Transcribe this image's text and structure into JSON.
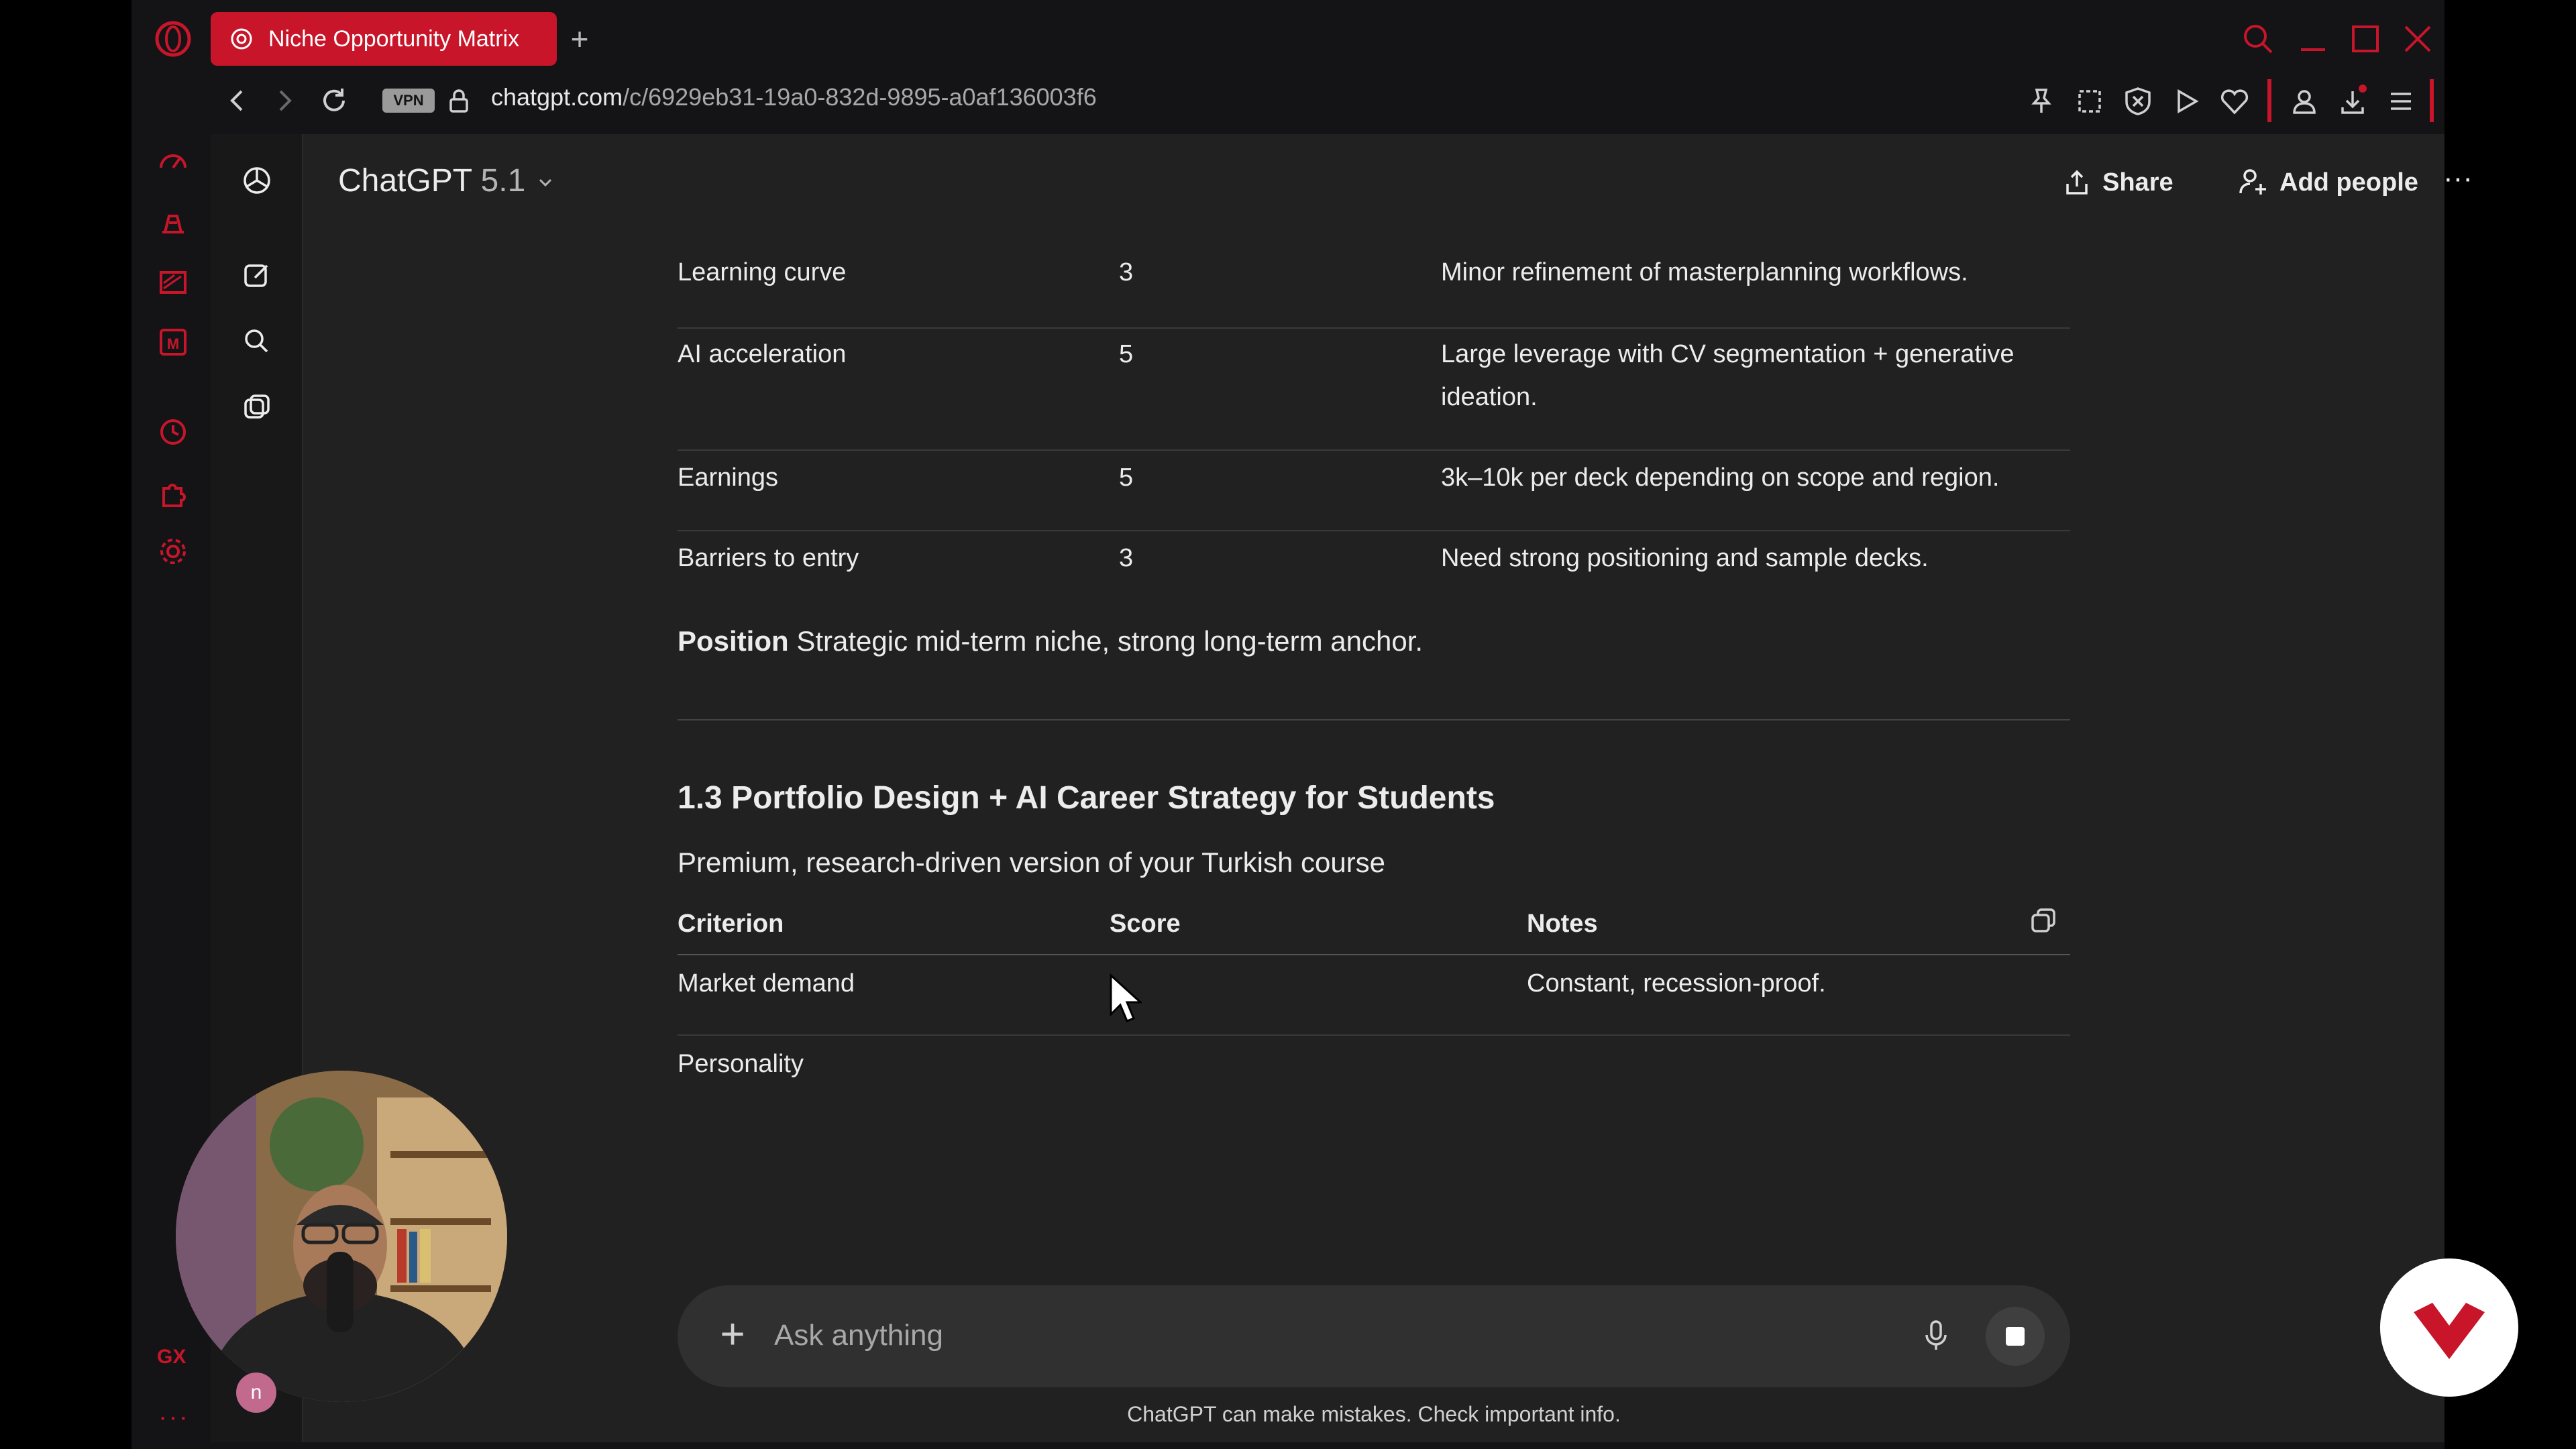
{
  "browser": {
    "tab_title": "Niche Opportunity Matrix",
    "new_tab_label": "+",
    "url_host": "chatgpt.com",
    "url_path": "/c/6929eb31-19a0-832d-9895-a0af136003f6",
    "vpn_label": "VPN",
    "gx_label": "GX",
    "more_label": "···",
    "accent_color": "#c8152a"
  },
  "chat": {
    "model_name": "ChatGPT",
    "model_version": "5.1",
    "share_label": "Share",
    "add_people_label": "Add people",
    "more_label": "···"
  },
  "table1": {
    "rows": [
      {
        "criterion": "Learning curve",
        "score": "3",
        "notes": "Minor refinement of masterplanning workflows."
      },
      {
        "criterion": "AI acceleration",
        "score": "5",
        "notes_line1": "Large leverage with CV segmentation + generative",
        "notes_line2": "ideation."
      },
      {
        "criterion": "Earnings",
        "score": "5",
        "notes": "3k–10k per deck depending on scope and region."
      },
      {
        "criterion": "Barriers to entry",
        "score": "3",
        "notes": "Need strong positioning and sample decks."
      }
    ]
  },
  "position": {
    "label": "Position",
    "text": " Strategic mid-term niche, strong long-term anchor."
  },
  "section": {
    "heading": "1.3 Portfolio Design + AI Career Strategy for Students",
    "subtitle": "Premium, research-driven version of your Turkish course"
  },
  "table2": {
    "headers": {
      "criterion": "Criterion",
      "score": "Score",
      "notes": "Notes"
    },
    "rows": [
      {
        "criterion": "Market demand",
        "score": "",
        "notes": "Constant, recession-proof."
      },
      {
        "criterion": "Personality",
        "score": "",
        "notes": ""
      }
    ]
  },
  "composer": {
    "placeholder": "Ask anything",
    "plus_label": "+"
  },
  "disclaimer": "ChatGPT can make mistakes. Check important info.",
  "avatar_initial": "n"
}
